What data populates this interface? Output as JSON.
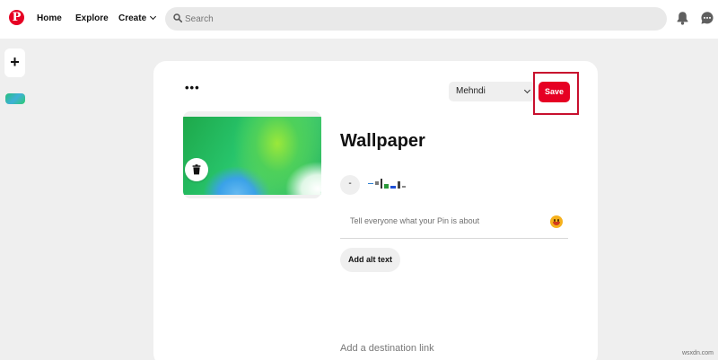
{
  "nav": {
    "logo": "P",
    "home": "Home",
    "explore": "Explore",
    "create": "Create",
    "search_placeholder": "Search"
  },
  "sidebar": {
    "add_label": "+"
  },
  "card": {
    "more_label": "•••",
    "board_selected": "Mehndi",
    "save_label": "Save",
    "title": "Wallpaper",
    "avatar_initial": "-",
    "description_placeholder": "Tell everyone what your Pin is about",
    "alt_text_label": "Add alt text",
    "destination_placeholder": "Add a destination link"
  },
  "watermark": "wsxdn.com",
  "colors": {
    "brand": "#e60023",
    "highlight_border": "#c8102e"
  },
  "icons": [
    "pinterest-logo-icon",
    "chevron-down-icon",
    "search-icon",
    "bell-icon",
    "chat-icon",
    "plus-icon",
    "trash-icon",
    "emoji-icon"
  ]
}
